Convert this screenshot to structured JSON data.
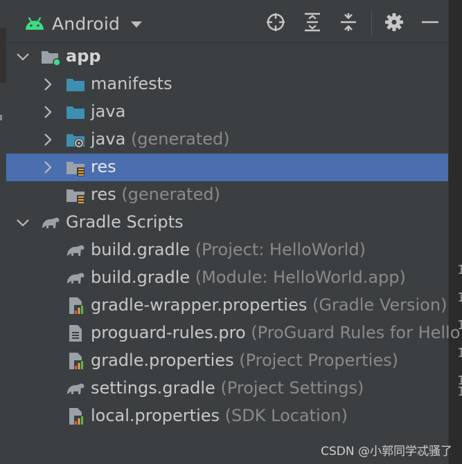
{
  "toolbar": {
    "view_label": "Android",
    "icons": [
      "android-icon",
      "dropdown-caret-icon",
      "locate-icon",
      "expand-all-icon",
      "collapse-all-icon",
      "gear-icon",
      "hide-icon"
    ]
  },
  "tree": {
    "app": {
      "label": "app"
    },
    "manifests": {
      "label": "manifests"
    },
    "java": {
      "label": "java"
    },
    "java_generated": {
      "label": "java",
      "hint": "(generated)"
    },
    "res": {
      "label": "res"
    },
    "res_generated": {
      "label": "res",
      "hint": "(generated)"
    },
    "gradle_scripts": {
      "label": "Gradle Scripts"
    },
    "build_gradle_project": {
      "label": "build.gradle",
      "hint": "(Project: HelloWorld)"
    },
    "build_gradle_module": {
      "label": "build.gradle",
      "hint": "(Module: HelloWorld.app)"
    },
    "gradle_wrapper": {
      "label": "gradle-wrapper.properties",
      "hint": "(Gradle Version)"
    },
    "proguard": {
      "label": "proguard-rules.pro",
      "hint": "(ProGuard Rules for Hello"
    },
    "gradle_properties": {
      "label": "gradle.properties",
      "hint": "(Project Properties)"
    },
    "settings_gradle": {
      "label": "settings.gradle",
      "hint": "(Project Settings)"
    },
    "local_properties": {
      "label": "local.properties",
      "hint": "(SDK Location)"
    }
  },
  "right_gutter": [
    "1",
    "1",
    "1",
    "1",
    "1",
    "1"
  ],
  "watermark": "CSDN @小郭同学忒骚了",
  "colors": {
    "panel_bg": "#3c3f41",
    "selection": "#4b6eaf",
    "folder_blue": "#3d8fb3",
    "folder_gray": "#9aa2a8",
    "android_green": "#3ddc84",
    "hint_gray": "#8a8a8a"
  }
}
